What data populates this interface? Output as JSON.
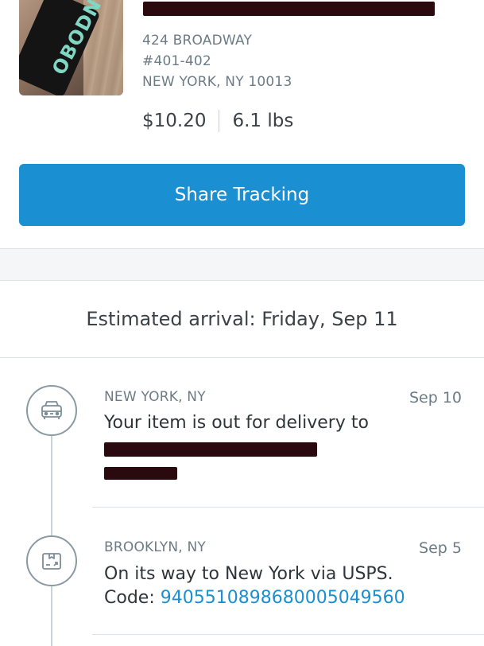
{
  "package": {
    "address_line1": "424 BROADWAY",
    "address_line2": "#401-402",
    "address_line3": "NEW YORK, NY 10013",
    "price": "$10.20",
    "weight": "6.1 lbs",
    "share_label": "Share Tracking"
  },
  "estimated_arrival": "Estimated arrival: Friday, Sep 11",
  "events": [
    {
      "location": "NEW YORK, NY",
      "date": "Sep 10",
      "message": "Your item is out for delivery to",
      "icon": "truck-icon"
    },
    {
      "location": "BROOKLYN, NY",
      "date": "Sep 5",
      "message": "On its way to New York via USPS.",
      "code_label": "Code: ",
      "code": "9405510898680005049560",
      "icon": "package-icon"
    }
  ],
  "colors": {
    "accent": "#1a8fd1",
    "muted_text": "#6c7c86",
    "redaction": "#2a0a0e"
  }
}
